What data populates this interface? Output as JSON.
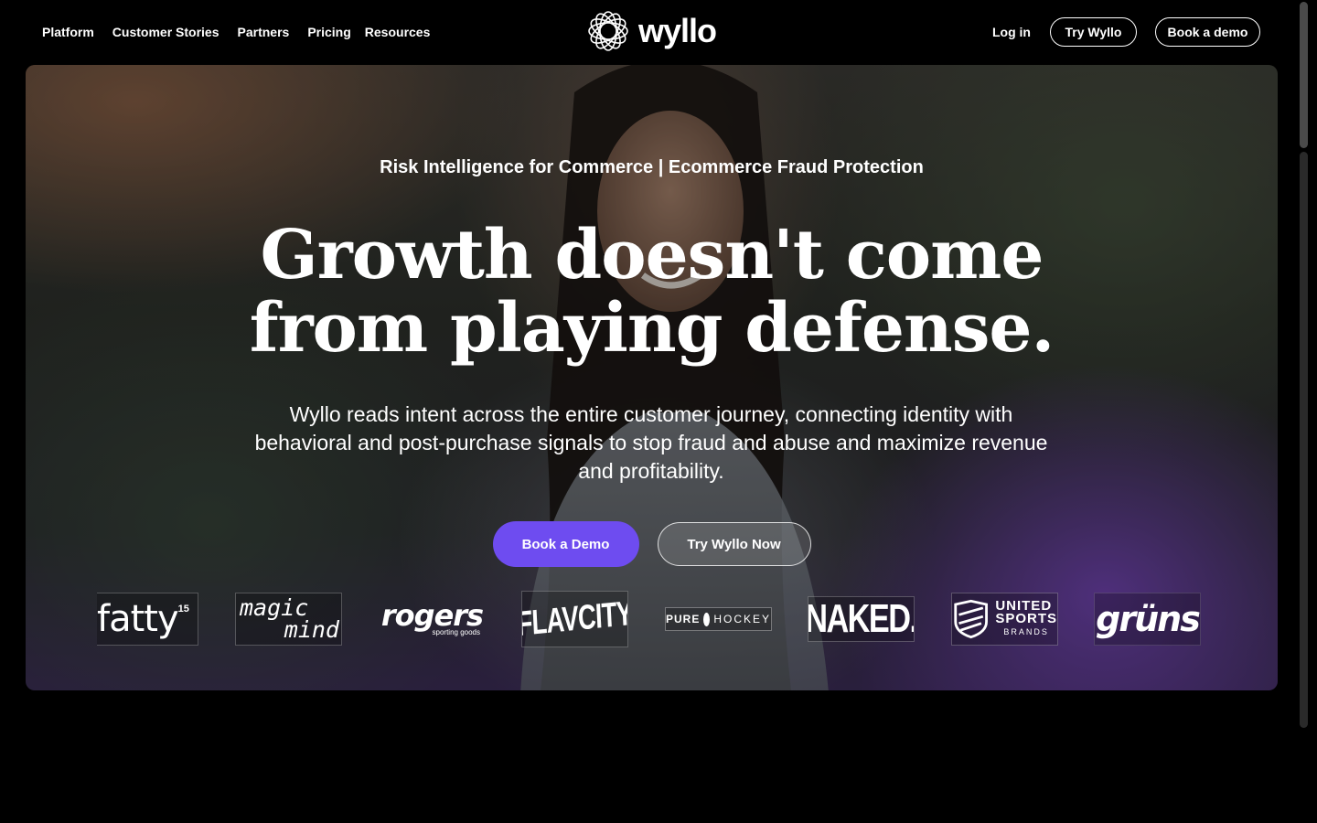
{
  "nav": {
    "links": [
      "Platform",
      "Customer Stories",
      "Partners",
      "Pricing",
      "Resources"
    ],
    "logo_text": "wyllo",
    "login_label": "Log in",
    "try_label": "Try Wyllo",
    "demo_label": "Book a demo"
  },
  "hero": {
    "eyebrow": "Risk Intelligence for Commerce | Ecommerce Fraud Protection",
    "headline_line1": "Growth doesn't come",
    "headline_line2": "from playing defense.",
    "subcopy": "Wyllo reads intent across the entire customer journey, connecting identity with behavioral and post-purchase signals to stop fraud and abuse and maximize revenue and profitability.",
    "primary_cta": "Book a Demo",
    "secondary_cta": "Try Wyllo Now"
  },
  "customer_logos": [
    {
      "name": "fatty15",
      "text": "fatty",
      "sup": "15"
    },
    {
      "name": "magic mind",
      "line1": "magic",
      "line2": "mind"
    },
    {
      "name": "rogers sporting goods",
      "text": "rogers",
      "sub": "sporting goods"
    },
    {
      "name": "FlavCity",
      "text": "FLAVCITY"
    },
    {
      "name": "Pure Hockey",
      "text1": "PURE",
      "text2": "HOCKEY"
    },
    {
      "name": "NAKED",
      "text": "NAKED."
    },
    {
      "name": "United Sports Brands",
      "line1": "UNITED",
      "line2": "SPORTS",
      "line3": "BRANDS"
    },
    {
      "name": "grüns",
      "text": "grüns"
    }
  ],
  "colors": {
    "accent": "#6e4cf0",
    "background": "#000000"
  }
}
